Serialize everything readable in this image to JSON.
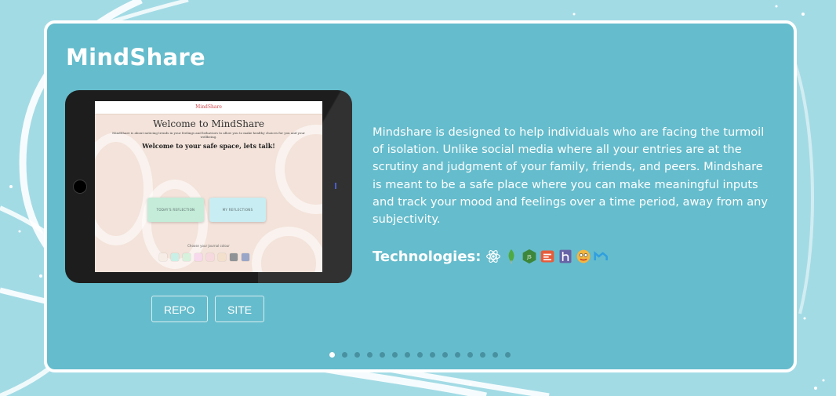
{
  "project": {
    "title": "MindShare",
    "description": "Mindshare is designed to help individuals who are facing the turmoil of isolation. Unlike social media where all your entries are at the scrutiny and judgment of your family, friends, and peers. Mindshare is meant to be a safe place where you can make meaningful inputs and track your mood and feelings over a time period, away from any subjectivity.",
    "technologies_label": "Technologies:",
    "technologies": [
      "react-icon",
      "mongodb-icon",
      "nodejs-icon",
      "express-icon",
      "heroku-icon",
      "handlebars-icon",
      "materialize-icon"
    ]
  },
  "preview": {
    "brand": "MindShare",
    "welcome": "Welcome to MindShare",
    "subtitle": "MindShare is about noticing trends in your feelings and behaviors to allow you to make healthy choices for you and your wellbeing.",
    "safe_space": "Welcome to your safe space, lets talk!",
    "button_today": "TODAY'S REFLECTION",
    "button_my": "MY REFLECTIONS",
    "choose_color": "Choose your journal colour",
    "swatch_colors": [
      "#f6ede6",
      "#c9f0e6",
      "#d6f1dc",
      "#f7d8ec",
      "#f6d9df",
      "#f3e0cc",
      "#8f9396",
      "#9aa6c7"
    ]
  },
  "actions": {
    "repo_label": "REPO",
    "site_label": "SITE"
  },
  "carousel": {
    "total": 15,
    "active_index": 0
  },
  "colors": {
    "background": "#a3dbe5",
    "card": "#65bccc",
    "card_border": "#ffffff",
    "text": "#ffffff"
  }
}
